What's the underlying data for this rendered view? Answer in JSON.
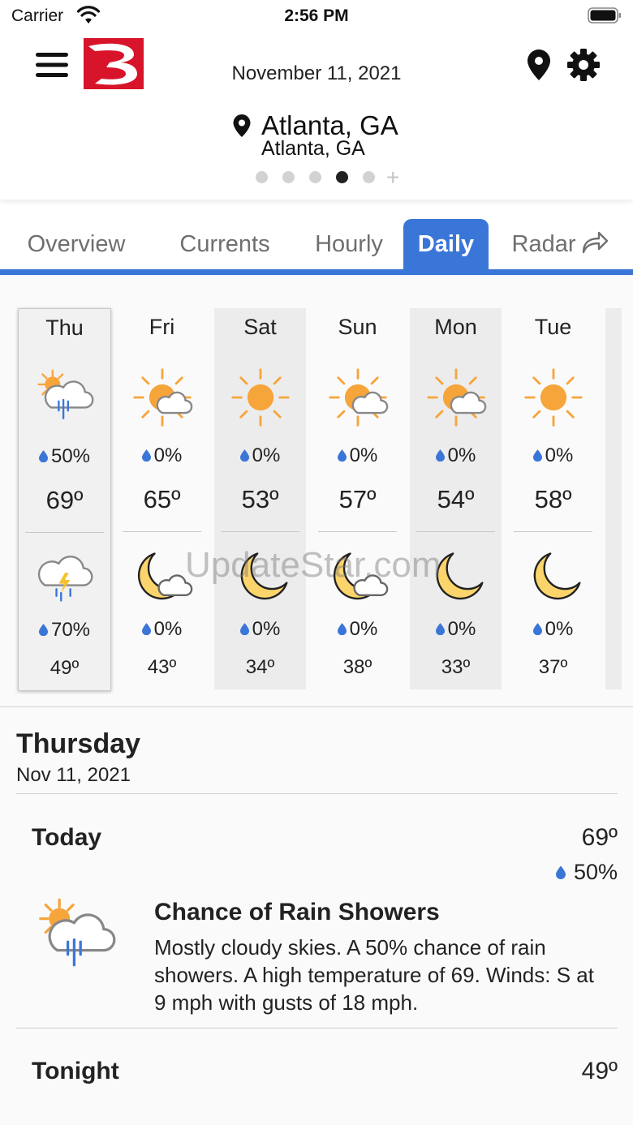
{
  "status_bar": {
    "carrier": "Carrier",
    "time": "2:56 PM"
  },
  "header": {
    "date": "November 11, 2021",
    "location_name": "Atlanta, GA",
    "location_sub": "Atlanta, GA",
    "page_count": 5,
    "active_page": 4
  },
  "tabs": [
    {
      "label": "Overview",
      "active": false
    },
    {
      "label": "Currents",
      "active": false
    },
    {
      "label": "Hourly",
      "active": false
    },
    {
      "label": "Daily",
      "active": true
    },
    {
      "label": "Radar",
      "active": false
    }
  ],
  "days": [
    {
      "name": "Thu",
      "day_icon": "partly-sunny-rain-icon",
      "day_precip": "50%",
      "high": "69º",
      "night_icon": "thunderstorm-icon",
      "night_precip": "70%",
      "low": "49º"
    },
    {
      "name": "Fri",
      "day_icon": "partly-sunny-icon",
      "day_precip": "0%",
      "high": "65º",
      "night_icon": "moon-cloud-icon",
      "night_precip": "0%",
      "low": "43º"
    },
    {
      "name": "Sat",
      "day_icon": "sunny-icon",
      "day_precip": "0%",
      "high": "53º",
      "night_icon": "moon-icon",
      "night_precip": "0%",
      "low": "34º"
    },
    {
      "name": "Sun",
      "day_icon": "partly-sunny-icon",
      "day_precip": "0%",
      "high": "57º",
      "night_icon": "moon-cloud-icon",
      "night_precip": "0%",
      "low": "38º"
    },
    {
      "name": "Mon",
      "day_icon": "partly-sunny-icon",
      "day_precip": "0%",
      "high": "54º",
      "night_icon": "moon-icon",
      "night_precip": "0%",
      "low": "33º"
    },
    {
      "name": "Tue",
      "day_icon": "sunny-icon",
      "day_precip": "0%",
      "high": "58º",
      "night_icon": "moon-icon",
      "night_precip": "0%",
      "low": "37º"
    }
  ],
  "detail": {
    "day": "Thursday",
    "date": "Nov 11, 2021",
    "today": {
      "title": "Today",
      "temp": "69º",
      "precip": "50%",
      "icon": "partly-sunny-rain-icon",
      "condition": "Chance of Rain Showers",
      "description": "Mostly cloudy skies.  A 50% chance of rain showers.  A high temperature of 69.  Winds: S at 9 mph with gusts of 18 mph."
    },
    "tonight": {
      "title": "Tonight",
      "temp": "49º"
    }
  },
  "watermark": "UpdateStar.com",
  "colors": {
    "accent": "#3a76d8",
    "sun": "#f6a53a",
    "moon": "#fbd46b",
    "logo_red": "#d7142a"
  }
}
